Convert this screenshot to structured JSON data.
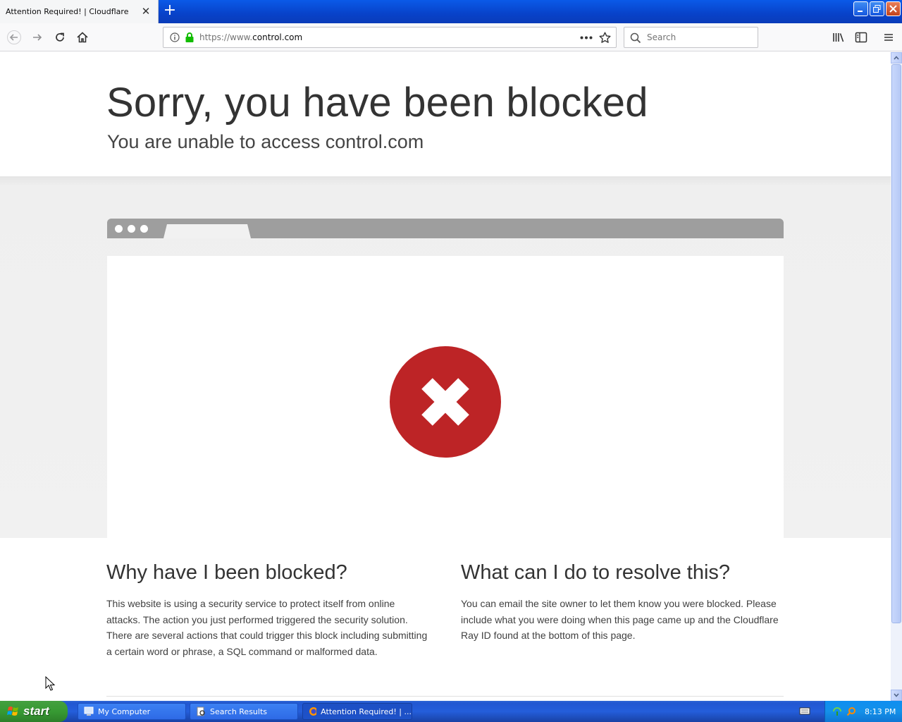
{
  "browser": {
    "tab_title": "Attention Required! | Cloudflare",
    "url_prefix": "https://www.",
    "url_domain": "control.com",
    "search_placeholder": "Search"
  },
  "page": {
    "headline": "Sorry, you have been blocked",
    "subheadline": "You are unable to access control.com",
    "why": {
      "heading": "Why have I been blocked?",
      "body": "This website is using a security service to protect itself from online attacks. The action you just performed triggered the security solution. There are several actions that could trigger this block including submitting a certain word or phrase, a SQL command or malformed data."
    },
    "resolve": {
      "heading": "What can I do to resolve this?",
      "body": "You can email the site owner to let them know you were blocked. Please include what you were doing when this page came up and the Cloudflare Ray ID found at the bottom of this page."
    },
    "error_color": "#bd2426"
  },
  "taskbar": {
    "start_label": "start",
    "tasks": [
      {
        "label": "My Computer",
        "icon": "computer-icon"
      },
      {
        "label": "Search Results",
        "icon": "search-results-icon"
      },
      {
        "label": "Attention Required! | ...",
        "icon": "firefox-icon",
        "active": true
      }
    ],
    "clock": "8:13 PM"
  }
}
